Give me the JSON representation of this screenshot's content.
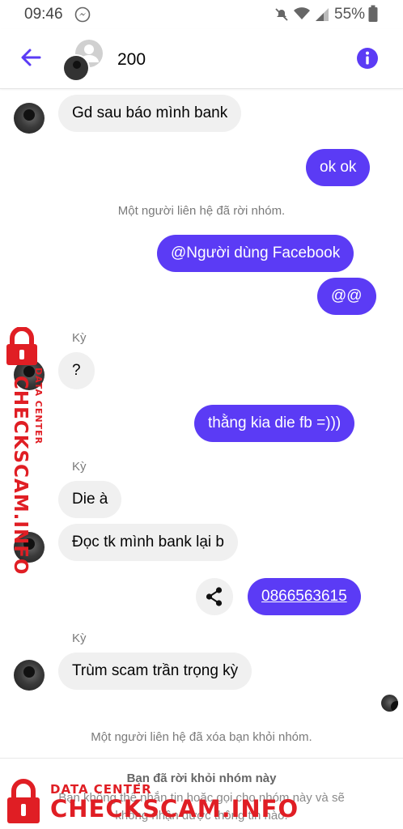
{
  "status_bar": {
    "time": "09:46",
    "battery": "55%"
  },
  "header": {
    "title": "200"
  },
  "messages": {
    "m1": "Gd sau báo mình bank",
    "m2": "ok ok",
    "sys1": "Một người liên hệ đã rời nhóm.",
    "m3": "@Người dùng Facebook",
    "m4": "@@",
    "sender1": "Kỳ",
    "m5": "?",
    "m6": "thằng kia die fb =)))",
    "sender2": "Kỳ",
    "m7": "Die à",
    "m8": "Đọc tk mình bank lại b",
    "m9": "0866563615",
    "sender3": "Kỳ",
    "m10": "Trùm scam trần trọng kỳ",
    "sys2": "Một người liên hệ đã xóa bạn khỏi nhóm."
  },
  "footer": {
    "title": "Bạn đã rời khỏi nhóm này",
    "desc": "Bạn không thể nhắn tin hoặc gọi cho nhóm này và sẽ không nhận được thông tin nào."
  },
  "watermark": {
    "small": "DATA CENTER",
    "big": "CHECKSCAM.INFO"
  },
  "colors": {
    "accent": "#5b3bf5",
    "incoming_bubble": "#f0f0f0",
    "watermark": "#e01e24"
  }
}
